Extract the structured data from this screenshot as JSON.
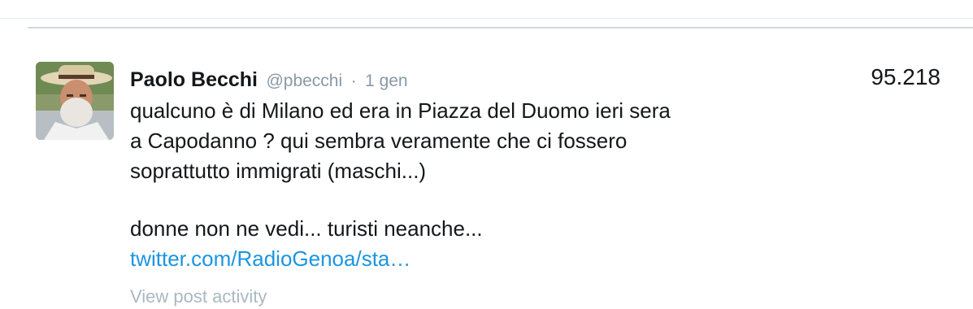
{
  "tweet": {
    "author_name": "Paolo Becchi",
    "handle": "@pbecchi",
    "separator": "·",
    "date": "1 gen",
    "impressions": "95.218",
    "text_lines": [
      "qualcuno è di Milano ed era in Piazza del Duomo ieri sera",
      "a Capodanno ? qui sembra veramente che  ci fossero",
      "soprattutto immigrati (maschi...)",
      "donne non ne vedi... turisti neanche..."
    ],
    "link_text": "twitter.com/RadioGenoa/sta…",
    "activity_label": "View post activity"
  },
  "colors": {
    "link": "#1b95e0",
    "secondary_text": "#8899a6",
    "muted_link": "#aab8c2",
    "primary_text": "#14171a"
  }
}
